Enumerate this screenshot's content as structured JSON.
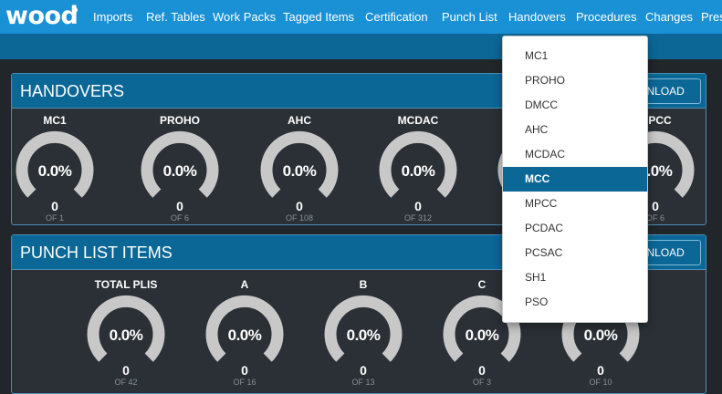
{
  "brand": {
    "logo": "wood"
  },
  "nav": [
    "Imports",
    "Ref. Tables",
    "Work Packs",
    "Tagged Items",
    "Certification",
    "Punch List",
    "Handovers",
    "Procedures",
    "Changes",
    "Pres"
  ],
  "handovers": {
    "title": "HANDOVERS",
    "download_label": "DOWNLOAD",
    "gauges": [
      {
        "label": "MC1",
        "pct": "0.0%",
        "value": "0",
        "of": "OF 1"
      },
      {
        "label": "PROHO",
        "pct": "0.0%",
        "value": "0",
        "of": "OF 6"
      },
      {
        "label": "AHC",
        "pct": "0.0%",
        "value": "0",
        "of": "OF 108"
      },
      {
        "label": "MCDAC",
        "pct": "0.0%",
        "value": "0",
        "of": "OF 312"
      },
      {
        "label": "",
        "pct": "",
        "value": "",
        "of": ""
      },
      {
        "label": "MPCC",
        "pct": "0.0%",
        "value": "0",
        "of": "OF 6"
      }
    ]
  },
  "punch": {
    "title": "PUNCH LIST ITEMS",
    "download_label": "DOWNLOAD",
    "gauges": [
      {
        "label": "TOTAL PLIS",
        "pct": "0.0%",
        "value": "0",
        "of": "OF 42"
      },
      {
        "label": "A",
        "pct": "0.0%",
        "value": "0",
        "of": "OF 16"
      },
      {
        "label": "B",
        "pct": "0.0%",
        "value": "0",
        "of": "OF 13"
      },
      {
        "label": "C",
        "pct": "0.0%",
        "value": "0",
        "of": "OF 3"
      },
      {
        "label": "",
        "pct": "0.0%",
        "value": "0",
        "of": "OF 10"
      }
    ]
  },
  "dropdown": {
    "items": [
      "MC1",
      "PROHO",
      "DMCC",
      "AHC",
      "MCDAC",
      "MCC",
      "MPCC",
      "PCDAC",
      "PCSAC",
      "SH1",
      "PSO"
    ],
    "selected": "MCC"
  },
  "colors": {
    "navbar": "#1991d4",
    "subbar": "#0c6796",
    "panel_header": "#0b6796",
    "background": "#21262b",
    "gauge_track": "#c8c8c8"
  }
}
